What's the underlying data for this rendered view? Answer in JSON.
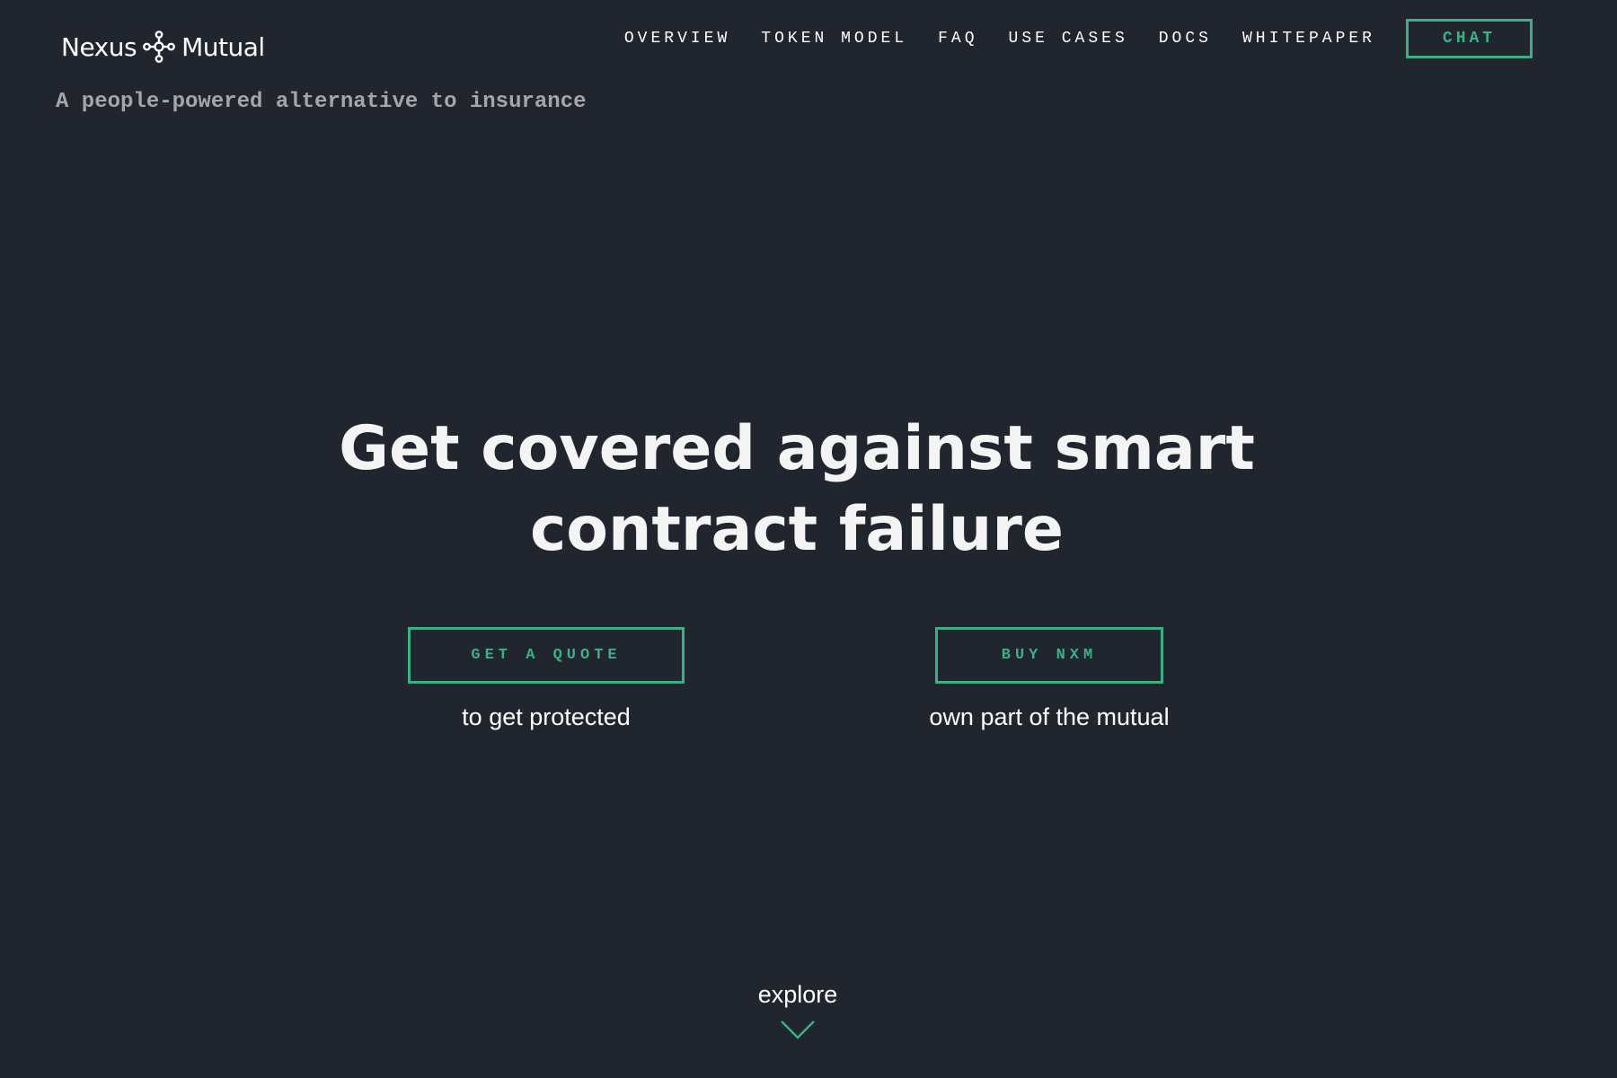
{
  "header": {
    "logo": {
      "word_left": "Nexus",
      "word_right": "Mutual",
      "icon": "nexus-mutual-logo-icon"
    },
    "tagline": "A people-powered alternative to insurance",
    "nav": {
      "items": [
        {
          "label": "OVERVIEW"
        },
        {
          "label": "TOKEN MODEL"
        },
        {
          "label": "FAQ"
        },
        {
          "label": "USE CASES"
        },
        {
          "label": "DOCS"
        },
        {
          "label": "WHITEPAPER"
        }
      ],
      "chat_label": "CHAT"
    }
  },
  "hero": {
    "title_line1": "Get covered against smart",
    "title_line2": "contract failure",
    "cta": [
      {
        "label": "GET A QUOTE",
        "caption": "to get protected"
      },
      {
        "label": "BUY NXM",
        "caption": "own part of the mutual"
      }
    ]
  },
  "explore": {
    "label": "explore",
    "icon": "chevron-down-icon"
  },
  "colors": {
    "background": "#21252e",
    "accent": "#3daf84",
    "text": "#ffffff",
    "tagline": "#a3a6ab"
  }
}
